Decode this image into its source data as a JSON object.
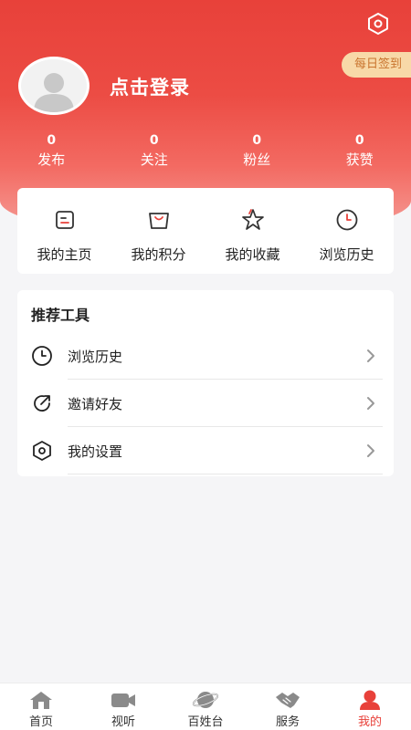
{
  "header": {
    "login_text": "点击登录",
    "checkin_label": "每日签到",
    "accent_color": "#e8413a",
    "settings_icon": "settings-hex-icon"
  },
  "stats": [
    {
      "count": "0",
      "label": "发布"
    },
    {
      "count": "0",
      "label": "关注"
    },
    {
      "count": "0",
      "label": "粉丝"
    },
    {
      "count": "0",
      "label": "获赞"
    }
  ],
  "quick_links": [
    {
      "label": "我的主页",
      "icon": "homepage-icon"
    },
    {
      "label": "我的积分",
      "icon": "points-bag-icon"
    },
    {
      "label": "我的收藏",
      "icon": "star-icon"
    },
    {
      "label": "浏览历史",
      "icon": "clock-icon"
    }
  ],
  "tools": {
    "title": "推荐工具",
    "items": [
      {
        "label": "浏览历史",
        "icon": "clock-icon"
      },
      {
        "label": "邀请好友",
        "icon": "share-icon"
      },
      {
        "label": "我的设置",
        "icon": "settings-hex-icon"
      }
    ]
  },
  "tabbar": {
    "items": [
      {
        "label": "首页",
        "icon": "home-icon"
      },
      {
        "label": "视听",
        "icon": "video-icon"
      },
      {
        "label": "百姓台",
        "icon": "planet-icon"
      },
      {
        "label": "服务",
        "icon": "handshake-icon"
      },
      {
        "label": "我的",
        "icon": "profile-icon"
      }
    ],
    "active": "我的"
  }
}
